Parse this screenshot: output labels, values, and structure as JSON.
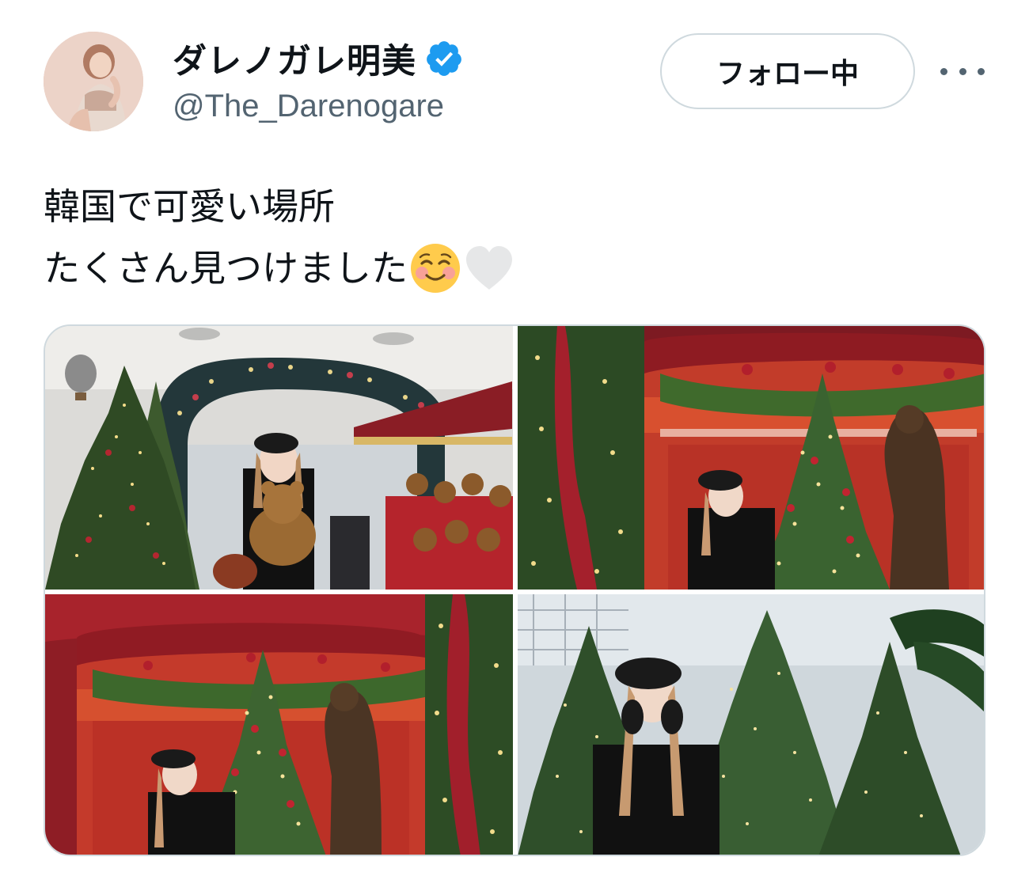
{
  "user": {
    "display_name": "ダレノガレ明美",
    "handle": "@The_Darenogare",
    "verified": true,
    "avatar_icon": "profile-photo"
  },
  "actions": {
    "follow_label": "フォロー中",
    "more_icon": "more-horizontal-icon"
  },
  "tweet": {
    "lines": [
      "韓国で可愛い場所",
      "たくさん見つけました"
    ],
    "emojis": [
      "smiling-face-with-blush-icon",
      "white-heart-icon"
    ]
  },
  "media": [
    {
      "name": "photo-christmas-arch-teddy-bear"
    },
    {
      "name": "photo-window-display-tree-bear"
    },
    {
      "name": "photo-window-display-red-frame"
    },
    {
      "name": "photo-christmas-trees-beret"
    }
  ],
  "colors": {
    "verified_blue": "#1d9bf0",
    "text_primary": "#0f1419",
    "text_secondary": "#536471",
    "border": "#cfd9de"
  }
}
